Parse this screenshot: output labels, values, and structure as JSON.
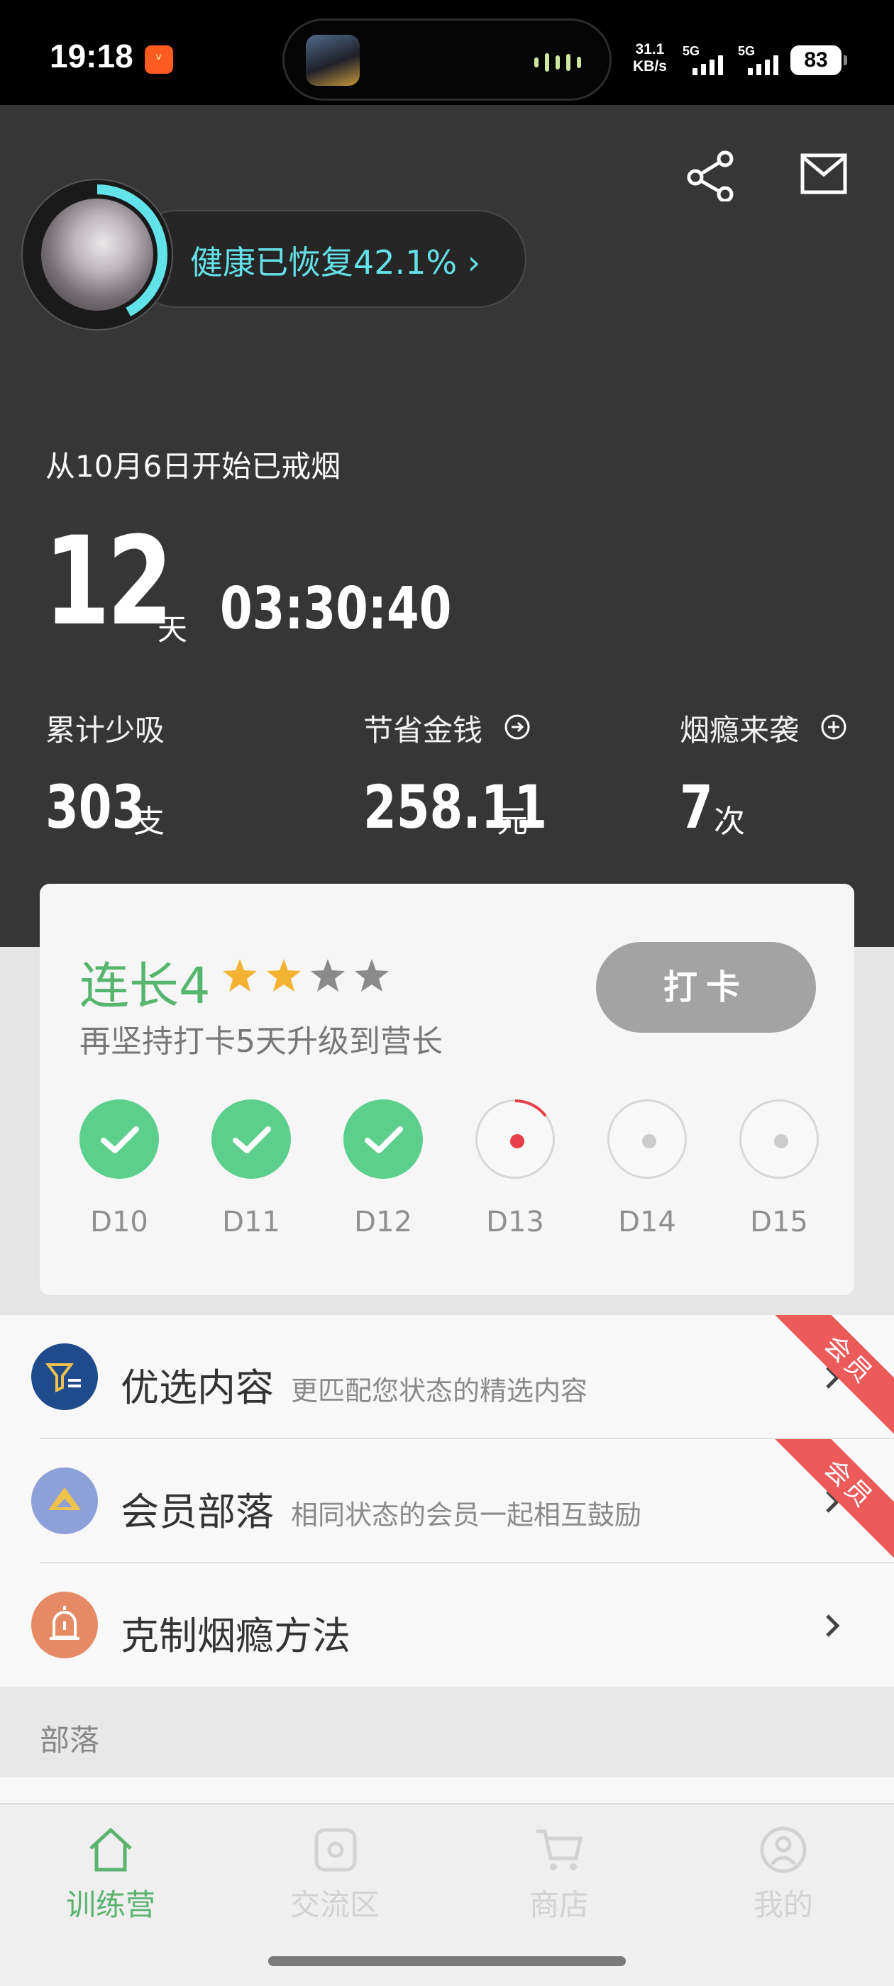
{
  "status_bar": {
    "time": "19:18",
    "app_badge": "ᵛ",
    "net_speed_value": "31.1",
    "net_speed_unit": "KB/s",
    "sim1": "5G",
    "sim2": "5G",
    "battery": "83"
  },
  "header": {
    "share_icon": "share-icon",
    "mail_icon": "mail-icon",
    "health_text": "健康已恢复42.1%",
    "health_progress": 0.421,
    "since_text": "从10月6日开始已戒烟",
    "days": "12",
    "days_unit": "天",
    "clock": "03:30:40"
  },
  "stats": [
    {
      "label": "累计少吸",
      "value": "303",
      "unit": "支",
      "icon": ""
    },
    {
      "label": "节省金钱",
      "value": "258.11",
      "unit": "元",
      "icon": "arrow-circle-icon"
    },
    {
      "label": "烟瘾来袭",
      "value": "7",
      "unit": "次",
      "icon": "plus-circle-icon"
    }
  ],
  "level_card": {
    "title": "连长4",
    "stars_filled": 2,
    "stars_total": 4,
    "subtitle": "再坚持打卡5天升级到营长",
    "checkin_label": "打卡",
    "days": [
      {
        "label": "D10",
        "state": "done"
      },
      {
        "label": "D11",
        "state": "done"
      },
      {
        "label": "D12",
        "state": "done"
      },
      {
        "label": "D13",
        "state": "today"
      },
      {
        "label": "D14",
        "state": "pending"
      },
      {
        "label": "D15",
        "state": "pending"
      }
    ]
  },
  "menu": [
    {
      "title": "优选内容",
      "desc": "更匹配您状态的精选内容",
      "badge": "会员",
      "icon": "filter-icon",
      "color": "#1f4b8c"
    },
    {
      "title": "会员部落",
      "desc": "相同状态的会员一起相互鼓励",
      "badge": "会员",
      "icon": "tribe-icon",
      "color": "#8ea0d8"
    },
    {
      "title": "克制烟瘾方法",
      "desc": "",
      "badge": "",
      "icon": "alarm-icon",
      "color": "#e58a65"
    }
  ],
  "section_label": "部落",
  "tabs": [
    {
      "label": "训练营",
      "icon": "home-icon",
      "active": true
    },
    {
      "label": "交流区",
      "icon": "chat-icon",
      "active": false
    },
    {
      "label": "商店",
      "icon": "cart-icon",
      "active": false
    },
    {
      "label": "我的",
      "icon": "profile-icon",
      "active": false
    }
  ],
  "colors": {
    "accent_green": "#5bb36f",
    "health_cyan": "#64e0e8",
    "check_green": "#5ccf8c",
    "member_red": "#ec5a5a",
    "header_bg": "#363636"
  }
}
